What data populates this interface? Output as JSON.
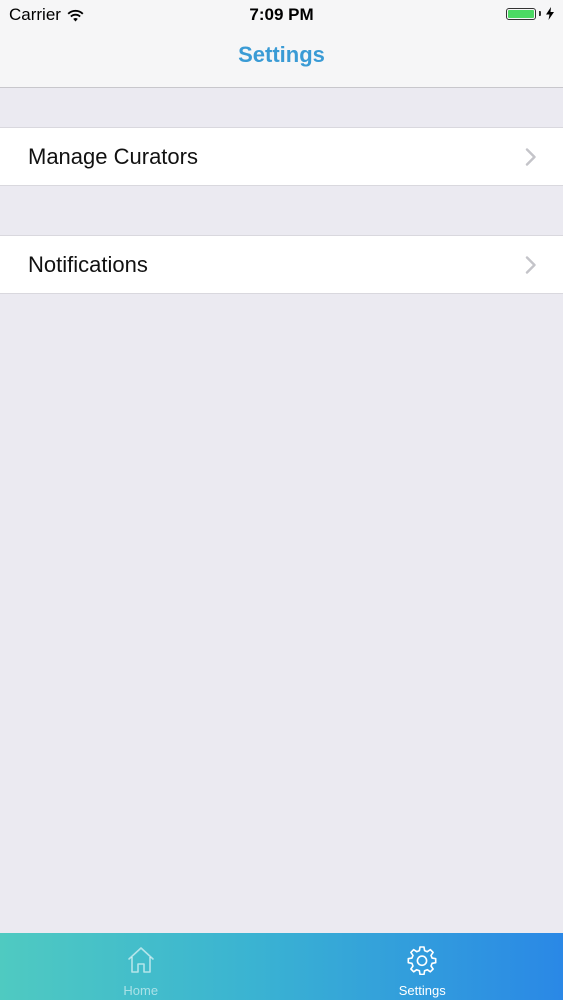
{
  "status_bar": {
    "carrier": "Carrier",
    "time": "7:09 PM",
    "battery_level": 1.0,
    "battery_color": "#4cd964",
    "wifi_icon": "wifi-icon",
    "charging_icon": "bolt-icon"
  },
  "nav": {
    "title": "Settings",
    "title_color": "#3a9bd5"
  },
  "settings_list": {
    "items": [
      {
        "label": "Manage Curators",
        "icon": "chevron-right-icon"
      },
      {
        "label": "Notifications",
        "icon": "chevron-right-icon"
      }
    ]
  },
  "tab_bar": {
    "tabs": [
      {
        "label": "Home",
        "icon": "home-icon",
        "selected": false
      },
      {
        "label": "Settings",
        "icon": "gear-icon",
        "selected": true
      }
    ],
    "gradient": [
      "#4fcac1",
      "#3ab3d2",
      "#2a88e6"
    ]
  }
}
